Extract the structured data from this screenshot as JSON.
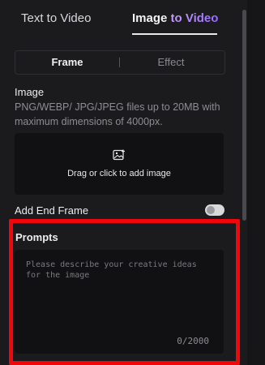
{
  "tabs": {
    "text_to_video": "Text to Video",
    "image_to_video_part1": "Image",
    "image_to_video_part2": "to Video"
  },
  "segmented": {
    "frame": "Frame",
    "effect": "Effect"
  },
  "image_section": {
    "title": "Image",
    "description": "PNG/WEBP/ JPG/JPEG files up to 20MB with maximum dimensions of 4000px.",
    "upload_text": "Drag or click to add image"
  },
  "end_frame": {
    "label": "Add End Frame",
    "enabled": false
  },
  "prompts": {
    "title": "Prompts",
    "placeholder": "Please describe your creative ideas for the image",
    "counter": "0/2000"
  },
  "colors": {
    "accent_gradient_start": "#c49cff",
    "accent_gradient_end": "#9b6bff",
    "highlight": "#f0070b"
  }
}
